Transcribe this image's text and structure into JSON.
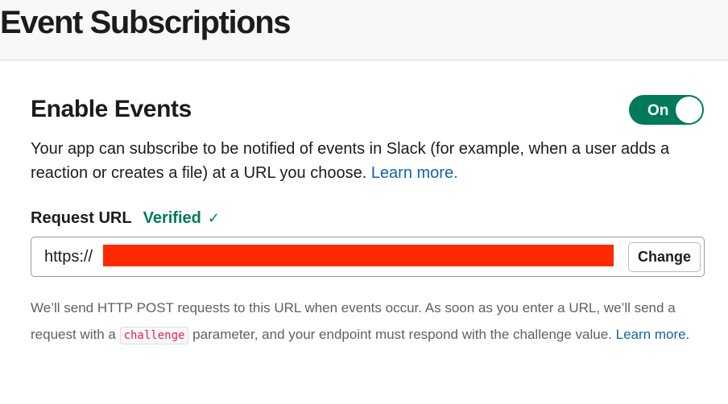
{
  "header": {
    "title": "Event Subscriptions"
  },
  "enable_events": {
    "title": "Enable Events",
    "toggle_label": "On",
    "toggle_state": "on",
    "description": "Your app can subscribe to be notified of events in Slack (for example, when a user adds a reaction or creates a file) at a URL you choose.",
    "learn_more": "Learn more."
  },
  "request_url": {
    "label": "Request URL",
    "status": "Verified",
    "status_icon": "check-icon",
    "value_prefix": "https://",
    "value_redacted": true,
    "change_button": "Change"
  },
  "help": {
    "text_before": "We’ll send HTTP POST requests to this URL when events occur. As soon as you enter a URL, we’ll send a request with a",
    "code": "challenge",
    "text_after": "parameter, and your endpoint must respond with the challenge value.",
    "learn_more": "Learn more."
  },
  "colors": {
    "accent_green": "#007a5a",
    "link_blue": "#1264a3",
    "code_pink": "#e01e5a",
    "redaction_red": "#ff2a00"
  }
}
